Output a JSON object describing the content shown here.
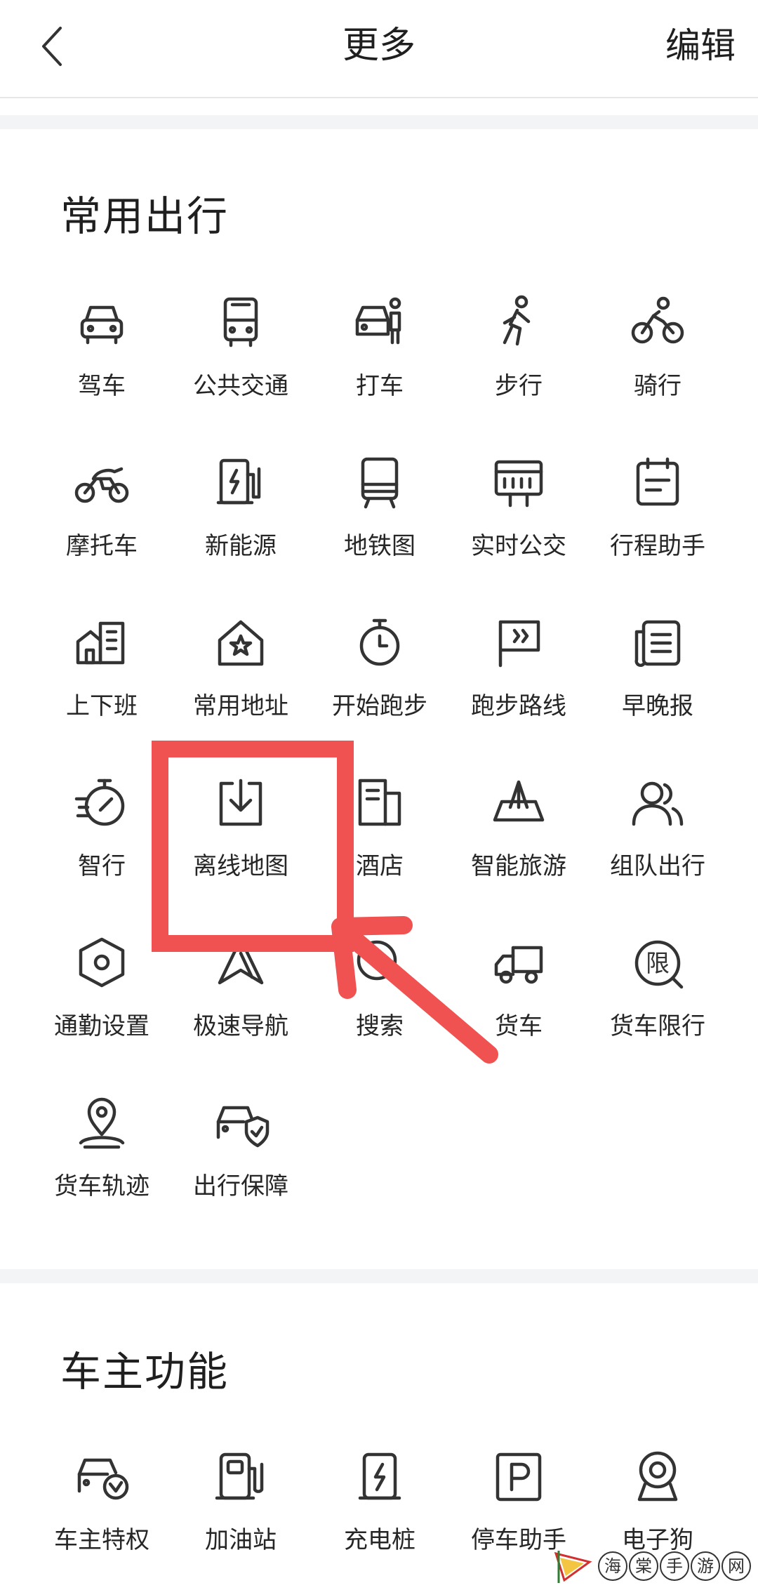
{
  "header": {
    "title": "更多",
    "edit_label": "编辑",
    "back_icon": "back-arrow-icon"
  },
  "colors": {
    "callout": "#ef5250",
    "text": "#1f1f1f",
    "band": "#f3f4f6"
  },
  "sections": [
    {
      "title": "常用出行",
      "items": [
        {
          "label": "驾车",
          "icon": "car-icon"
        },
        {
          "label": "公共交通",
          "icon": "bus-icon"
        },
        {
          "label": "打车",
          "icon": "taxi-icon"
        },
        {
          "label": "步行",
          "icon": "walk-icon"
        },
        {
          "label": "骑行",
          "icon": "bike-icon"
        },
        {
          "label": "摩托车",
          "icon": "motorcycle-icon"
        },
        {
          "label": "新能源",
          "icon": "ev-charger-icon"
        },
        {
          "label": "地铁图",
          "icon": "subway-icon"
        },
        {
          "label": "实时公交",
          "icon": "realtime-bus-icon"
        },
        {
          "label": "行程助手",
          "icon": "calendar-icon"
        },
        {
          "label": "上下班",
          "icon": "commute-icon"
        },
        {
          "label": "常用地址",
          "icon": "home-star-icon"
        },
        {
          "label": "开始跑步",
          "icon": "stopwatch-icon"
        },
        {
          "label": "跑步路线",
          "icon": "flag-route-icon"
        },
        {
          "label": "早晚报",
          "icon": "newspaper-icon"
        },
        {
          "label": "智行",
          "icon": "smart-gauge-icon"
        },
        {
          "label": "离线地图",
          "icon": "download-icon"
        },
        {
          "label": "酒店",
          "icon": "hotel-icon"
        },
        {
          "label": "智能旅游",
          "icon": "travel-icon"
        },
        {
          "label": "组队出行",
          "icon": "group-icon"
        },
        {
          "label": "通勤设置",
          "icon": "hex-settings-icon"
        },
        {
          "label": "极速导航",
          "icon": "navigation-icon"
        },
        {
          "label": "搜索",
          "icon": "search-icon"
        },
        {
          "label": "货车",
          "icon": "truck-icon"
        },
        {
          "label": "货车限行",
          "icon": "truck-limit-icon"
        },
        {
          "label": "货车轨迹",
          "icon": "truck-track-icon"
        },
        {
          "label": "出行保障",
          "icon": "car-shield-icon"
        }
      ]
    },
    {
      "title": "车主功能",
      "items": [
        {
          "label": "车主特权",
          "icon": "car-privilege-icon"
        },
        {
          "label": "加油站",
          "icon": "gas-station-icon"
        },
        {
          "label": "充电桩",
          "icon": "charging-pile-icon"
        },
        {
          "label": "停车助手",
          "icon": "parking-icon"
        },
        {
          "label": "电子狗",
          "icon": "camera-icon"
        }
      ]
    }
  ],
  "watermark": {
    "chars": [
      "海",
      "棠",
      "手",
      "游",
      "网"
    ]
  }
}
